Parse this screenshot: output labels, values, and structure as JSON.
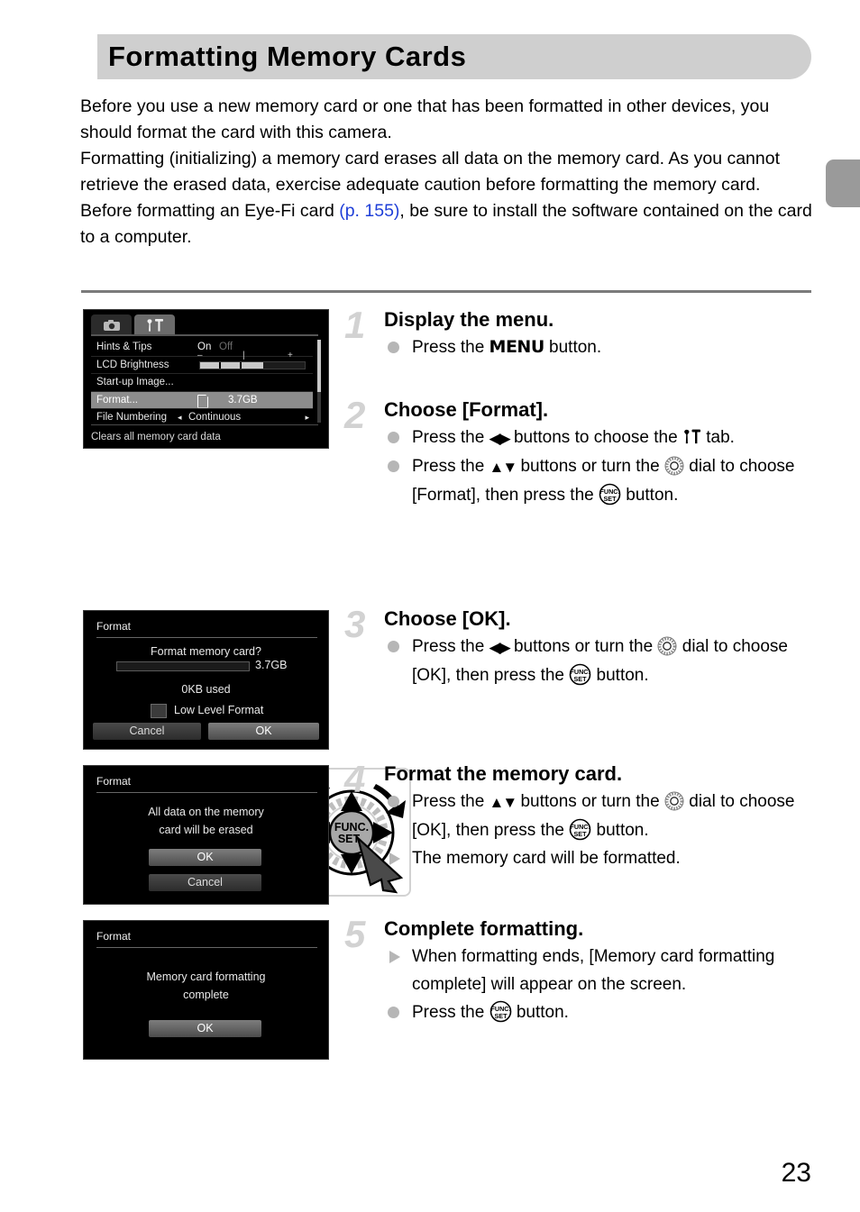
{
  "page": {
    "title": "Formatting Memory Cards",
    "number": "23",
    "edge_tab_label": ""
  },
  "intro": {
    "lines": [
      "Before you use a new memory card or one that has been formatted in other devices, you should format the card with this camera.",
      "Formatting (initializing) a memory card erases all data on the memory card. As you cannot retrieve the erased data, exercise adequate caution before formatting the memory card."
    ],
    "eyefi_before": "Before formatting an Eye-Fi card ",
    "eyefi_ref": "(p. 155)",
    "eyefi_after": ", be sure to install the software contained on the card to a computer."
  },
  "screens": {
    "menu": {
      "tab_camera_icon": "camera-icon",
      "tab_settings_icon": "wrench-hammer-icon",
      "rows": [
        {
          "label": "Hints & Tips",
          "value_on": "On",
          "value_off": "Off"
        },
        {
          "label": "LCD Brightness",
          "minus": "–",
          "mid": "|",
          "plus": "+"
        },
        {
          "label": "Start-up Image..."
        },
        {
          "label": "Format...",
          "value": "3.7GB",
          "selected": true
        },
        {
          "label": "File Numbering",
          "value": "Continuous",
          "left_arrow": "◂",
          "right_arrow": "▸"
        }
      ],
      "footer": "Clears all memory card data"
    },
    "confirm": {
      "title": "Format",
      "question": "Format memory card?",
      "capacity": "3.7GB",
      "used": "0KB used",
      "low_level_label": "Low Level Format",
      "cancel": "Cancel",
      "ok": "OK"
    },
    "erase_warning": {
      "title": "Format",
      "line1": "All data on the memory",
      "line2": "card will be erased",
      "ok": "OK",
      "cancel": "Cancel"
    },
    "complete": {
      "title": "Format",
      "line1": "Memory card formatting",
      "line2": "complete",
      "ok": "OK"
    }
  },
  "figures": {
    "menu_button": "MENU",
    "func_set_button_line1": "FUNC.",
    "func_set_button_line2": "SET"
  },
  "steps": [
    {
      "number": "1",
      "heading": "Display the menu.",
      "bullets": [
        {
          "marker": "dot",
          "parts": [
            {
              "t": "text",
              "v": "Press the "
            },
            {
              "t": "icon",
              "v": "menu-button-icon"
            },
            {
              "t": "text",
              "v": " button."
            }
          ]
        }
      ]
    },
    {
      "number": "2",
      "heading": "Choose [Format].",
      "bullets": [
        {
          "marker": "dot",
          "parts": [
            {
              "t": "text",
              "v": "Press the "
            },
            {
              "t": "icon",
              "v": "left-right-buttons-icon"
            },
            {
              "t": "text",
              "v": " buttons to choose the "
            },
            {
              "t": "icon",
              "v": "settings-tab-icon"
            },
            {
              "t": "text",
              "v": " tab."
            }
          ]
        },
        {
          "marker": "dot",
          "parts": [
            {
              "t": "text",
              "v": "Press the "
            },
            {
              "t": "icon",
              "v": "up-down-buttons-icon"
            },
            {
              "t": "text",
              "v": " buttons or turn the "
            },
            {
              "t": "icon",
              "v": "control-dial-icon"
            },
            {
              "t": "text",
              "v": " dial to choose [Format], then press the "
            },
            {
              "t": "icon",
              "v": "func-set-button-icon"
            },
            {
              "t": "text",
              "v": " button."
            }
          ]
        }
      ]
    },
    {
      "number": "3",
      "heading": "Choose [OK].",
      "bullets": [
        {
          "marker": "dot",
          "parts": [
            {
              "t": "text",
              "v": "Press the "
            },
            {
              "t": "icon",
              "v": "left-right-buttons-icon"
            },
            {
              "t": "text",
              "v": " buttons or turn the "
            },
            {
              "t": "icon",
              "v": "control-dial-icon"
            },
            {
              "t": "text",
              "v": " dial to choose [OK], then press the "
            },
            {
              "t": "icon",
              "v": "func-set-button-icon"
            },
            {
              "t": "text",
              "v": " button."
            }
          ]
        }
      ]
    },
    {
      "number": "4",
      "heading": "Format the memory card.",
      "bullets": [
        {
          "marker": "dot",
          "parts": [
            {
              "t": "text",
              "v": "Press the "
            },
            {
              "t": "icon",
              "v": "up-down-buttons-icon"
            },
            {
              "t": "text",
              "v": " buttons or turn the "
            },
            {
              "t": "icon",
              "v": "control-dial-icon"
            },
            {
              "t": "text",
              "v": " dial to choose [OK], then press the "
            },
            {
              "t": "icon",
              "v": "func-set-button-icon"
            },
            {
              "t": "text",
              "v": " button."
            }
          ]
        },
        {
          "marker": "tri",
          "parts": [
            {
              "t": "text",
              "v": "The memory card will be formatted."
            }
          ]
        }
      ]
    },
    {
      "number": "5",
      "heading": "Complete formatting.",
      "bullets": [
        {
          "marker": "tri",
          "parts": [
            {
              "t": "text",
              "v": "When formatting ends, [Memory card formatting complete] will appear on the screen."
            }
          ]
        },
        {
          "marker": "dot",
          "parts": [
            {
              "t": "text",
              "v": "Press the "
            },
            {
              "t": "icon",
              "v": "func-set-button-icon"
            },
            {
              "t": "text",
              "v": " button."
            }
          ]
        }
      ]
    }
  ],
  "colors": {
    "banner": "#cfcfcf",
    "link": "#1f3fd8",
    "step_number": "#d2d2d2",
    "marker": "#b6b6b6",
    "edge_tab": "#9a9a9a"
  }
}
